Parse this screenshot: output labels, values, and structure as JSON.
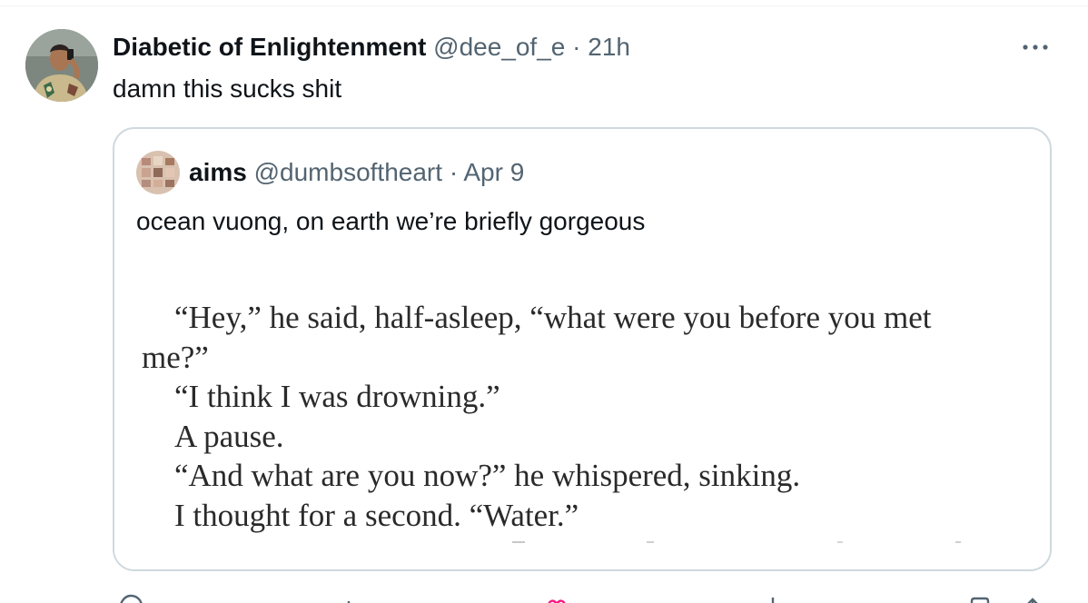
{
  "tweet": {
    "display_name": "Diabetic of Enlightenment",
    "handle": "@dee_of_e",
    "separator": "·",
    "time": "21h",
    "text": "damn this sucks shit"
  },
  "quoted_tweet": {
    "display_name": "aims",
    "handle": "@dumbsoftheart",
    "separator": "·",
    "date": "Apr 9",
    "text": "ocean vuong, on earth we’re briefly gorgeous",
    "image_text": {
      "line1": "“Hey,” he said, half-asleep, “what were you before you met",
      "line2": "me?”",
      "line3": "“I think I was drowning.”",
      "line4": "A pause.",
      "line5": "“And what are you now?” he whispered, sinking.",
      "line6": "I thought for a second. “Water.”"
    }
  },
  "icons": {
    "more": "more-horizontal-icon",
    "reply": "reply-icon",
    "retweet": "retweet-icon",
    "like": "heart-icon",
    "views": "views-icon",
    "bookmark": "bookmark-icon",
    "share": "share-icon"
  },
  "colors": {
    "text_primary": "#0f1419",
    "text_secondary": "#536471",
    "border": "#cfd9de",
    "like_accent": "#f91880"
  }
}
